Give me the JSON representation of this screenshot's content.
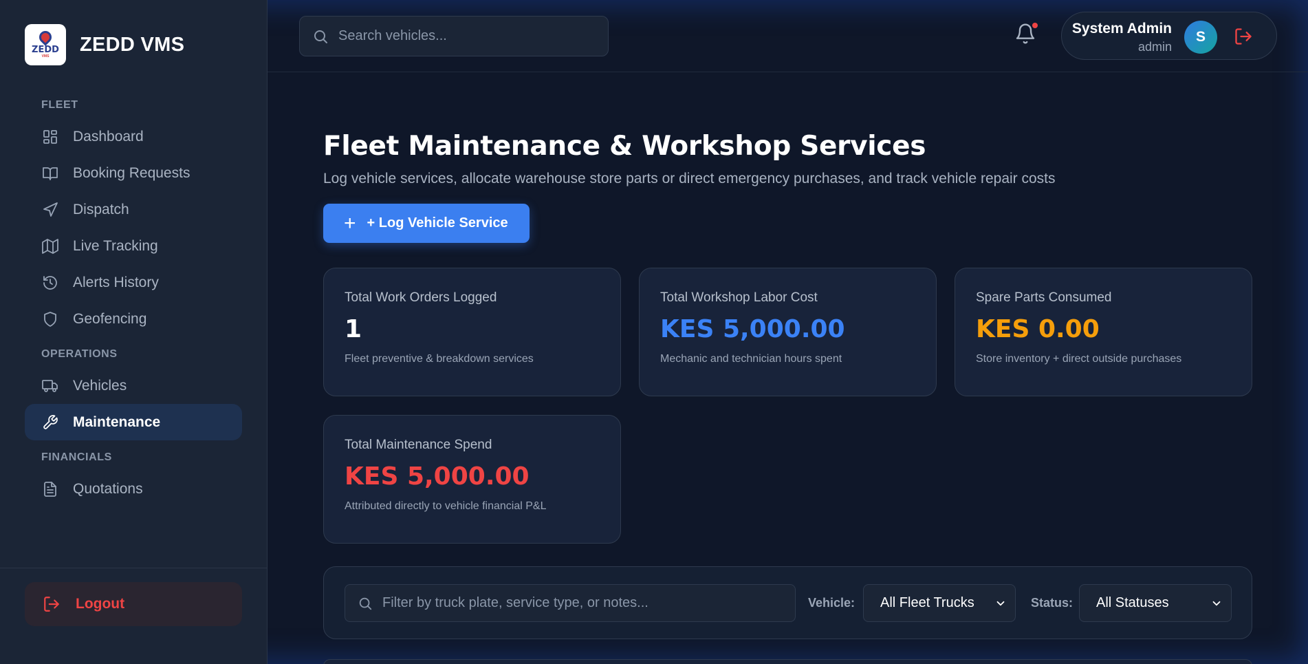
{
  "brand": {
    "name": "ZEDD VMS",
    "logo_text": "ZEDD",
    "logo_sub": "VMS"
  },
  "sidebar": {
    "sections": [
      {
        "label": "FLEET",
        "items": [
          {
            "label": "Dashboard",
            "icon": "dashboard-icon"
          },
          {
            "label": "Booking Requests",
            "icon": "book-icon"
          },
          {
            "label": "Dispatch",
            "icon": "navigation-icon"
          },
          {
            "label": "Live Tracking",
            "icon": "map-icon"
          },
          {
            "label": "Alerts History",
            "icon": "history-icon"
          },
          {
            "label": "Geofencing",
            "icon": "shield-icon"
          }
        ]
      },
      {
        "label": "OPERATIONS",
        "items": [
          {
            "label": "Vehicles",
            "icon": "truck-icon"
          },
          {
            "label": "Maintenance",
            "icon": "wrench-icon",
            "active": true
          }
        ]
      },
      {
        "label": "FINANCIALS",
        "items": [
          {
            "label": "Quotations",
            "icon": "document-icon"
          }
        ]
      }
    ],
    "logout_label": "Logout"
  },
  "topbar": {
    "search_placeholder": "Search vehicles...",
    "user": {
      "name": "System Admin",
      "role": "admin",
      "initial": "S"
    }
  },
  "page": {
    "title": "Fleet Maintenance & Workshop Services",
    "subtitle": "Log vehicle services, allocate warehouse store parts or direct emergency purchases, and track vehicle repair costs",
    "primary_button": "+ Log Vehicle Service"
  },
  "stats": [
    {
      "title": "Total Work Orders Logged",
      "value": "1",
      "desc": "Fleet preventive & breakdown services",
      "color": "#ffffff"
    },
    {
      "title": "Total Workshop Labor Cost",
      "value": "KES 5,000.00",
      "desc": "Mechanic and technician hours spent",
      "color": "#3b82f6"
    },
    {
      "title": "Spare Parts Consumed",
      "value": "KES 0.00",
      "desc": "Store inventory + direct outside purchases",
      "color": "#f59e0b"
    },
    {
      "title": "Total Maintenance Spend",
      "value": "KES 5,000.00",
      "desc": "Attributed directly to vehicle financial P&L",
      "color": "#ef4444"
    }
  ],
  "filters": {
    "search_placeholder": "Filter by truck plate, service type, or notes...",
    "vehicle_label": "Vehicle:",
    "vehicle_value": "All Fleet Trucks",
    "status_label": "Status:",
    "status_value": "All Statuses"
  }
}
